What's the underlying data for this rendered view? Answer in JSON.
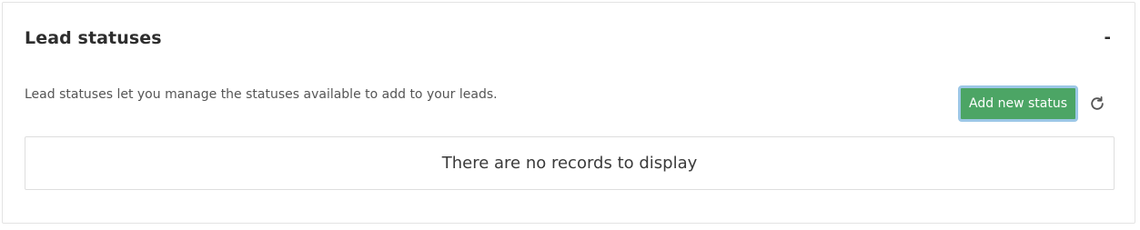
{
  "panel": {
    "title": "Lead statuses",
    "collapse_label": "-",
    "description": "Lead statuses let you manage the statuses available to add to your leads."
  },
  "toolbar": {
    "add_label": "Add new status",
    "add_color": "#4ca565",
    "refresh_icon": "refresh-icon"
  },
  "table": {
    "empty_message": "There are no records to display"
  }
}
